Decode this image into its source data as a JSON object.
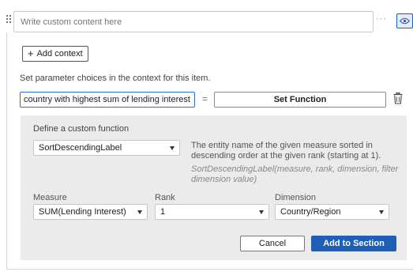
{
  "content": {
    "placeholder": "Write custom content here",
    "more_icon": "more-horizontal-icon",
    "view_icon": "eye-icon"
  },
  "context": {
    "add_label": "Add context",
    "instruction": "Set parameter choices in the context for this item.",
    "parameter_value": "country with highest sum of lending interest",
    "equals": "=",
    "set_function_label": "Set Function",
    "delete_icon": "trash-icon"
  },
  "custom_function": {
    "title": "Define a custom function",
    "function_selected": "SortDescendingLabel",
    "description": "The entity name of the given measure sorted in descending order at the given rank (starting at 1).",
    "signature": "SortDescendingLabel(measure, rank, dimension, filter dimension value)",
    "measure_label": "Measure",
    "measure_value": "SUM(Lending Interest)",
    "rank_label": "Rank",
    "rank_value": "1",
    "dimension_label": "Dimension",
    "dimension_value": "Country/Region",
    "cancel_label": "Cancel",
    "add_label": "Add to Section"
  },
  "colors": {
    "accent": "#1f5fb6",
    "panel_bg": "#ebebeb"
  }
}
